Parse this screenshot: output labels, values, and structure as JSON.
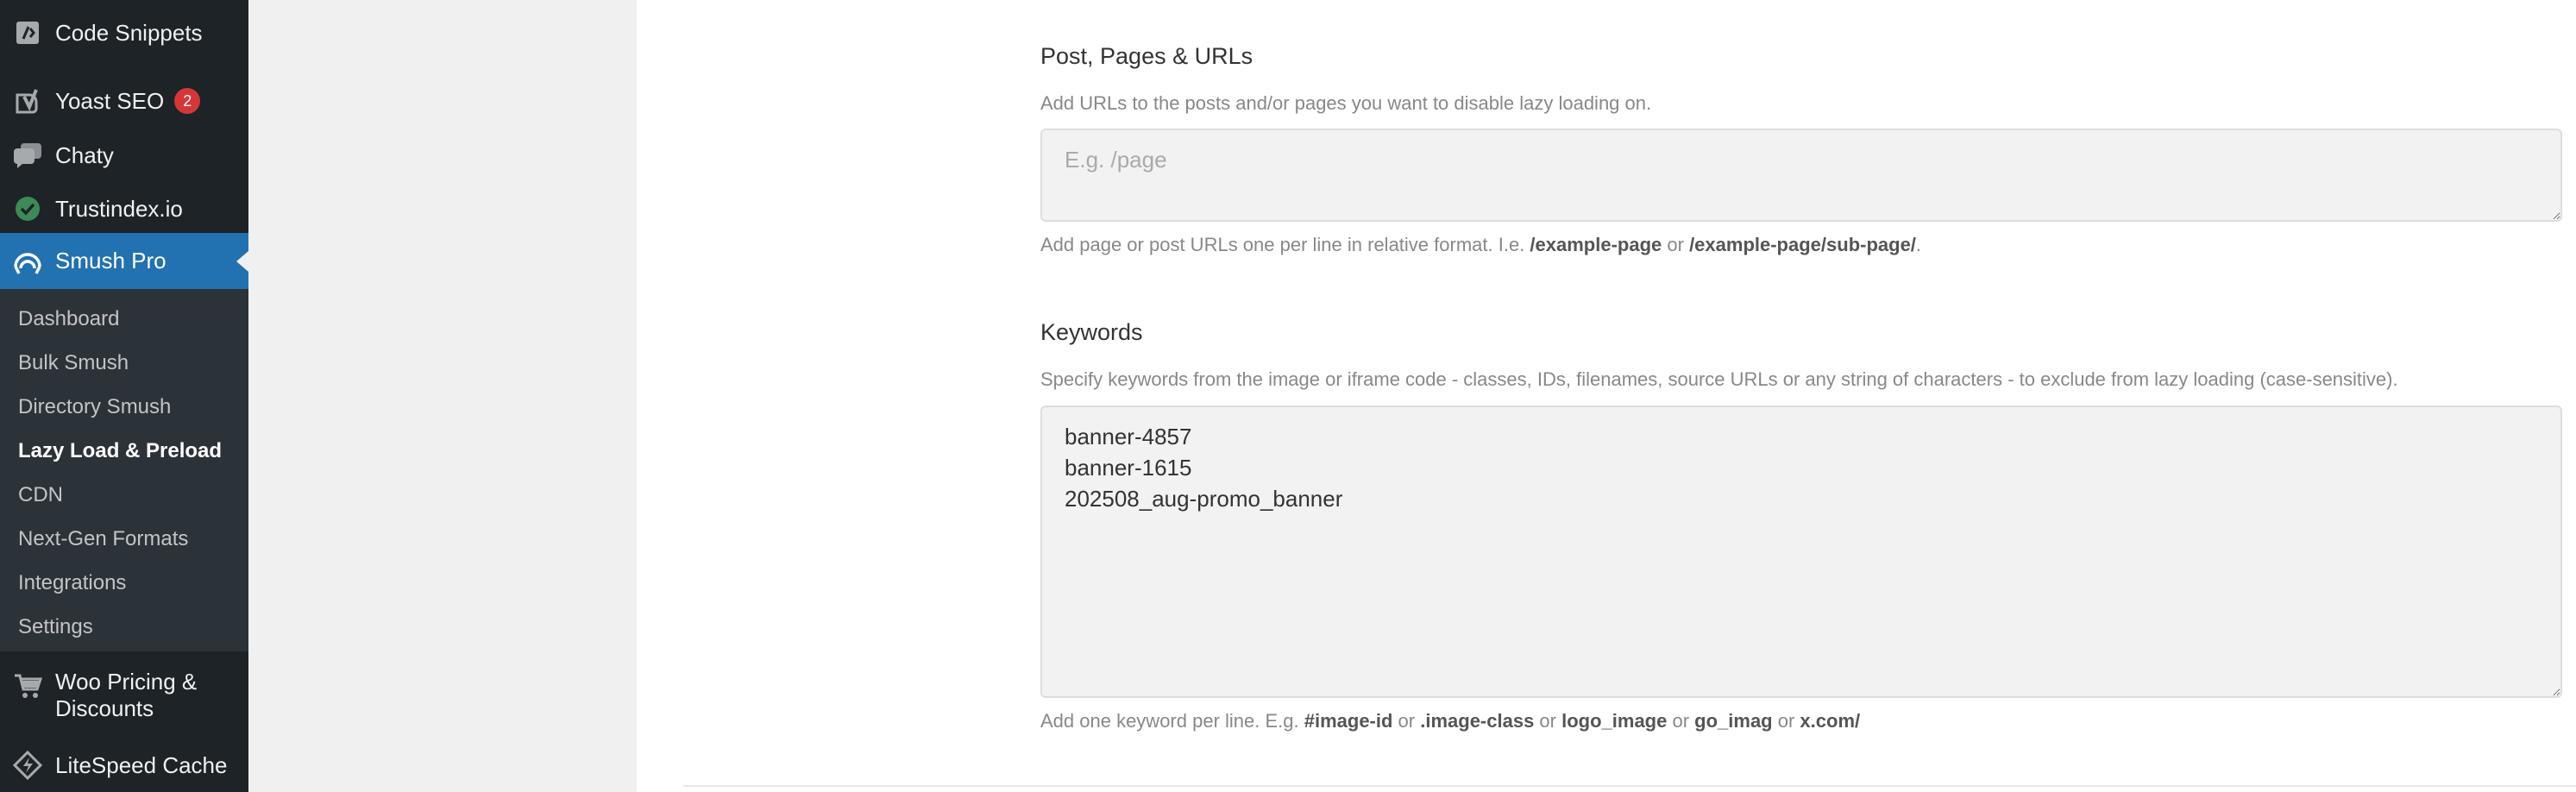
{
  "sidebar": {
    "code_snippets": "Code Snippets",
    "yoast": {
      "label": "Yoast SEO",
      "badge": "2"
    },
    "chaty": "Chaty",
    "trustindex": "Trustindex.io",
    "smush": "Smush Pro",
    "submenu": [
      "Dashboard",
      "Bulk Smush",
      "Directory Smush",
      "Lazy Load & Preload",
      "CDN",
      "Next-Gen Formats",
      "Integrations",
      "Settings"
    ],
    "woo_line1": "Woo Pricing &",
    "woo_line2": "Discounts",
    "litespeed": "LiteSpeed Cache"
  },
  "colors": {
    "sidebar_bg": "#1d2327",
    "submenu_bg": "#2c3338",
    "active_bg": "#2271b1",
    "badge_bg": "#d63638"
  },
  "urls_section": {
    "heading": "Post, Pages & URLs",
    "description": "Add URLs to the posts and/or pages you want to disable lazy loading on.",
    "placeholder": "E.g. /page",
    "value": "",
    "help_prefix": "Add page or post URLs one per line in relative format. I.e. ",
    "help_code1": "/example-page",
    "help_or": " or ",
    "help_code2": "/example-page/sub-page/",
    "help_end": "."
  },
  "keywords_section": {
    "heading": "Keywords",
    "description": "Specify keywords from the image or iframe code - classes, IDs, filenames, source URLs or any string of characters - to exclude from lazy loading (case-sensitive).",
    "value": "banner-4857\nbanner-1615\n202508_aug-promo_banner",
    "help_prefix": "Add one keyword per line. E.g. ",
    "examples": [
      "#image-id",
      ".image-class",
      "logo_image",
      "go_imag",
      "x.com/"
    ],
    "or": " or "
  }
}
